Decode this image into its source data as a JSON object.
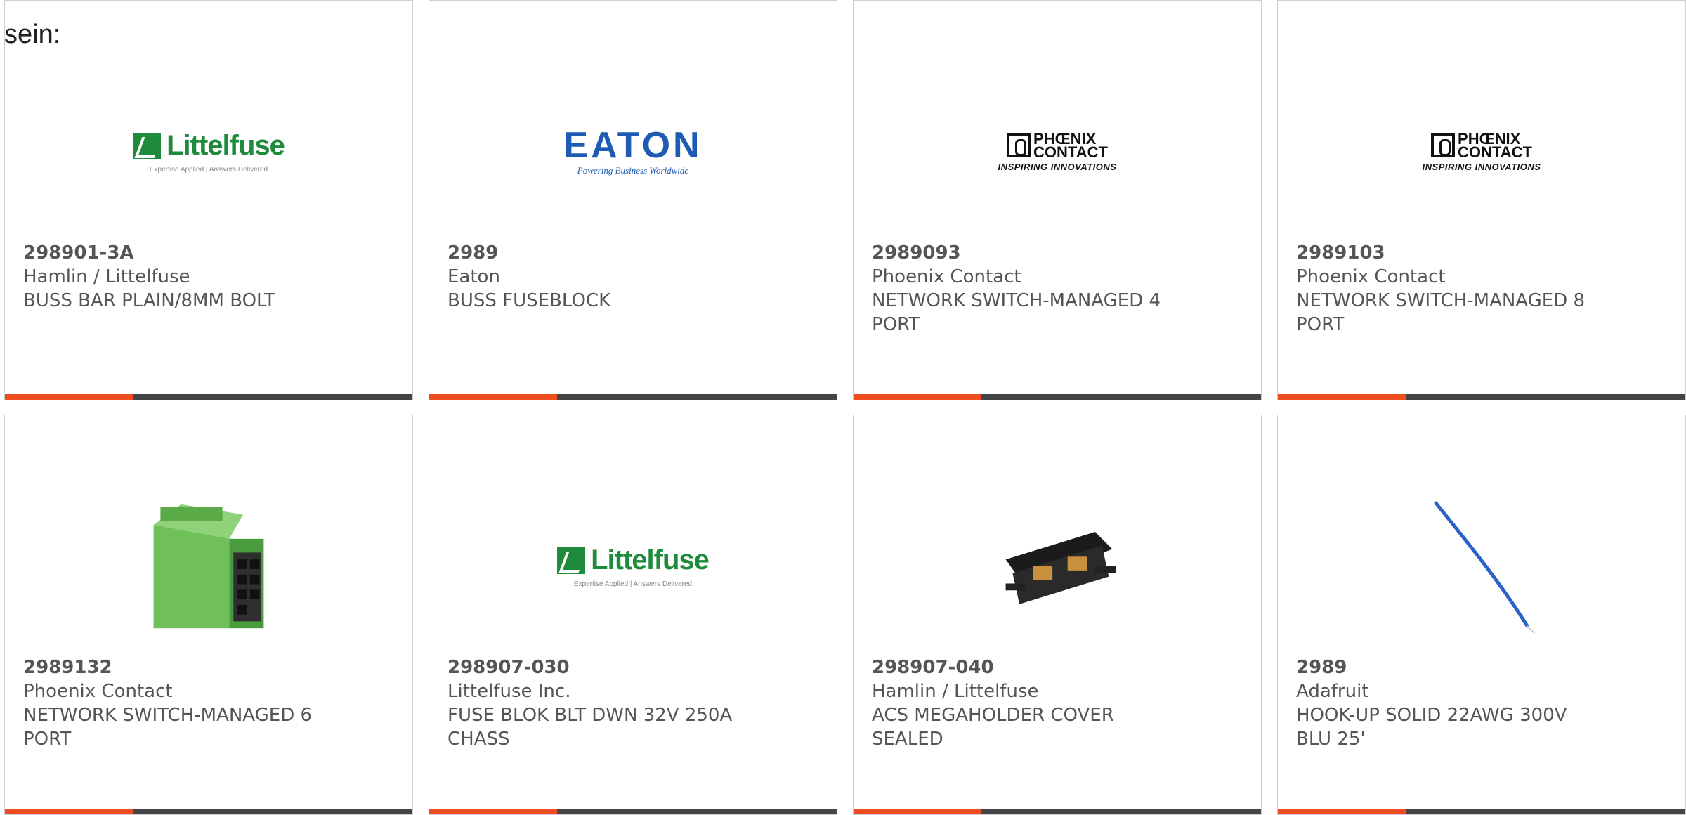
{
  "partial_text": "sein:",
  "products": [
    {
      "part": "298901-3A",
      "maker": "Hamlin / Littelfuse",
      "desc": "BUSS BAR PLAIN/8MM BOLT",
      "image": "littelfuse-logo"
    },
    {
      "part": "2989",
      "maker": "Eaton",
      "desc": "BUSS FUSEBLOCK",
      "image": "eaton-logo"
    },
    {
      "part": "2989093",
      "maker": "Phoenix Contact",
      "desc": "NETWORK SWITCH-MANAGED 4 PORT",
      "image": "phoenix-contact-logo"
    },
    {
      "part": "2989103",
      "maker": "Phoenix Contact",
      "desc": "NETWORK SWITCH-MANAGED 8 PORT",
      "image": "phoenix-contact-logo"
    },
    {
      "part": "2989132",
      "maker": "Phoenix Contact",
      "desc": "NETWORK SWITCH-MANAGED 6 PORT",
      "image": "network-switch-photo"
    },
    {
      "part": "298907-030",
      "maker": "Littelfuse Inc.",
      "desc": "FUSE BLOK BLT DWN 32V 250A CHASS",
      "image": "littelfuse-logo"
    },
    {
      "part": "298907-040",
      "maker": "Hamlin / Littelfuse",
      "desc": "ACS MEGAHOLDER COVER SEALED",
      "image": "fuse-holder-photo"
    },
    {
      "part": "2989",
      "maker": "Adafruit",
      "desc": "HOOK-UP SOLID 22AWG 300V BLU 25'",
      "image": "blue-wire-photo"
    }
  ],
  "logos": {
    "littelfuse": {
      "word": "Littelfuse",
      "tag": "Expertise Applied | Answers Delivered"
    },
    "eaton": {
      "word": "EATON",
      "tag": "Powering Business Worldwide"
    },
    "phoenix": {
      "line1": "PHŒNIX",
      "line2": "CONTACT",
      "tag": "INSPIRING INNOVATIONS"
    }
  },
  "colors": {
    "accent": "#ee4d1f",
    "bar": "#444444",
    "text": "#555555"
  }
}
